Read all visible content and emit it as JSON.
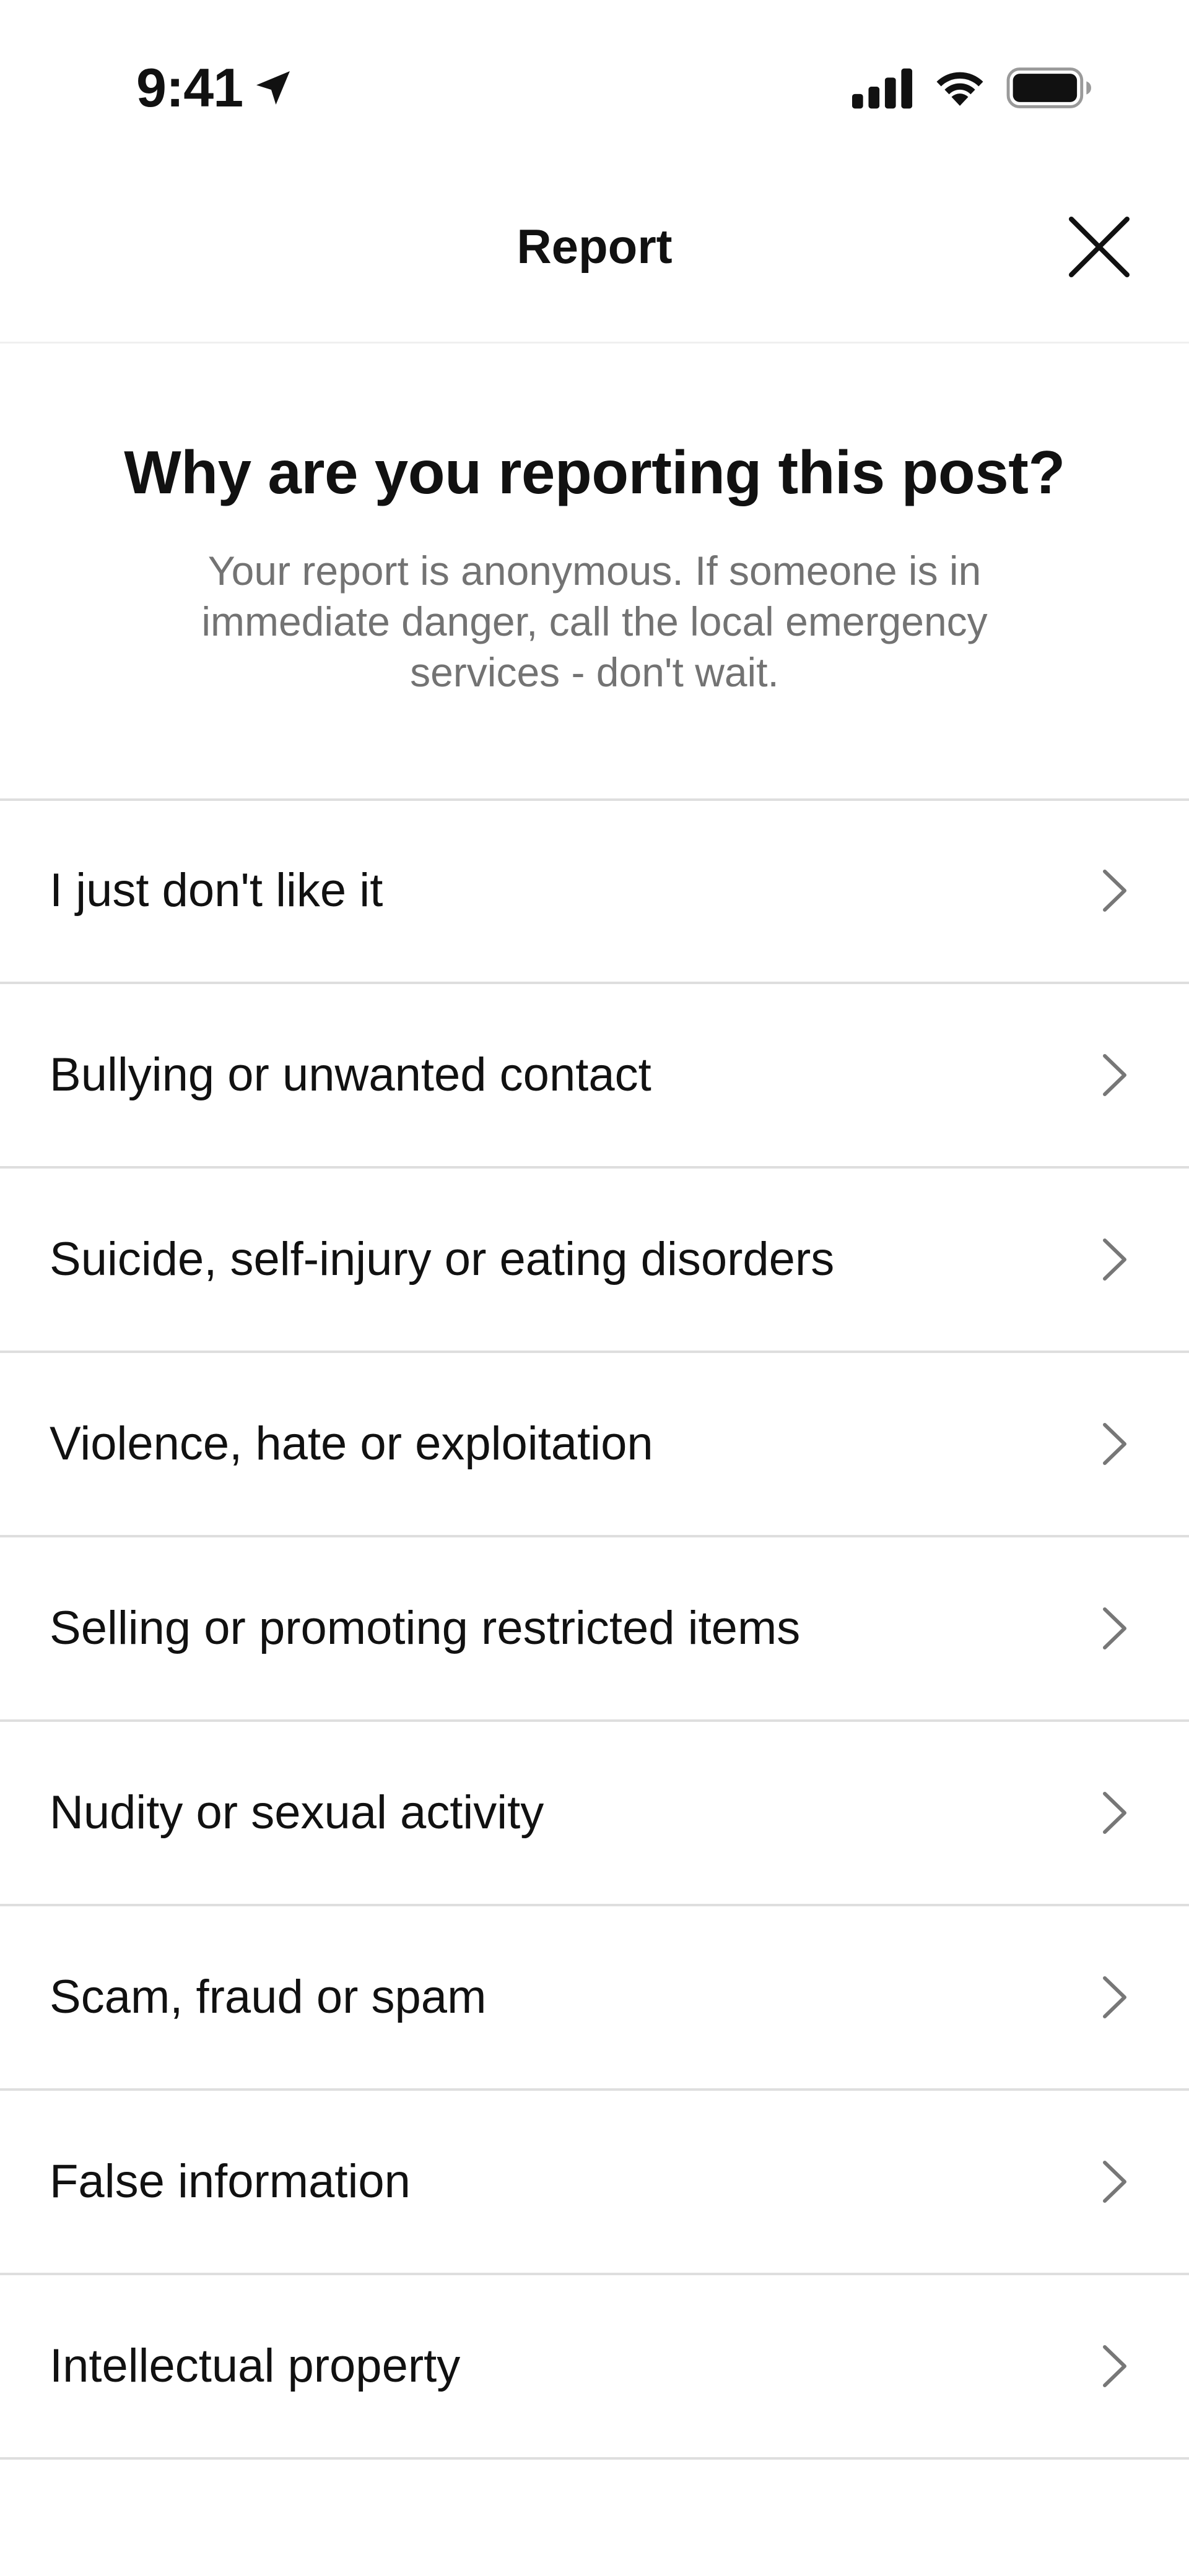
{
  "status_bar": {
    "time": "9:41",
    "icons": [
      "location-arrow-icon",
      "cellular-signal-icon",
      "wifi-icon",
      "battery-icon"
    ]
  },
  "header": {
    "title": "Report",
    "close_icon": "close-icon"
  },
  "intro": {
    "heading": "Why are you reporting this post?",
    "subtext": "Your report is anonymous. If someone is in immediate danger, call the local emergency services - don't wait."
  },
  "options": [
    {
      "label": "I just don't like it"
    },
    {
      "label": "Bullying or unwanted contact"
    },
    {
      "label": "Suicide, self-injury or eating disorders"
    },
    {
      "label": "Violence, hate or exploitation"
    },
    {
      "label": "Selling or promoting restricted items"
    },
    {
      "label": "Nudity or sexual activity"
    },
    {
      "label": "Scam, fraud or spam"
    },
    {
      "label": "False information"
    },
    {
      "label": "Intellectual property"
    }
  ],
  "colors": {
    "text_primary": "#111111",
    "text_secondary": "#737373",
    "divider": "#dedede",
    "background": "#ffffff"
  }
}
